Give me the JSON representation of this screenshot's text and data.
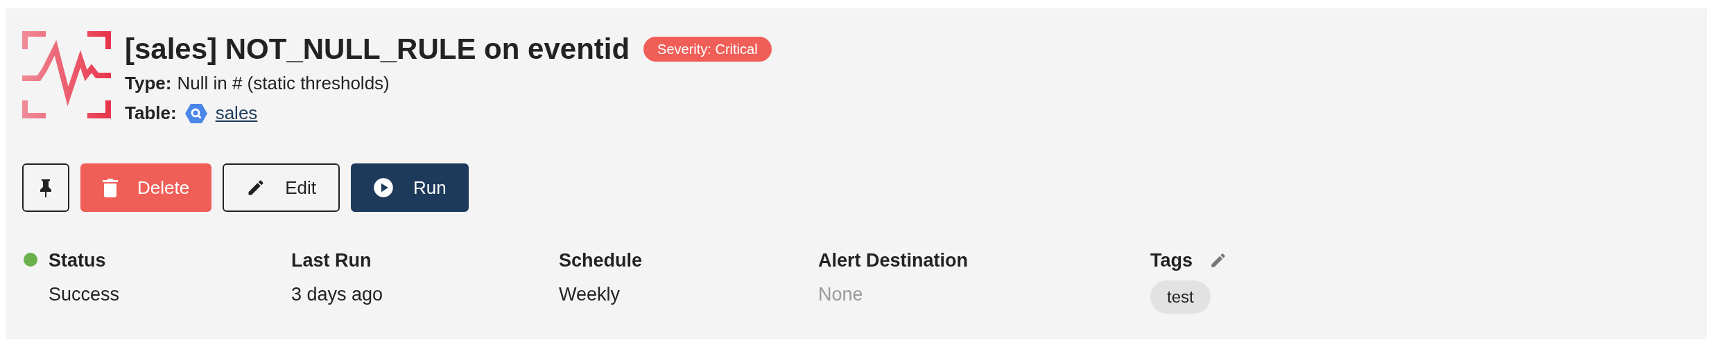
{
  "header": {
    "title": "[sales] NOT_NULL_RULE on eventid",
    "severity": "Severity: Critical",
    "type_label": "Type:",
    "type_value": "Null in # (static thresholds)",
    "table_label": "Table:",
    "table_link": "sales"
  },
  "buttons": [
    {
      "kind": "pin"
    },
    {
      "kind": "delete",
      "label": "Delete"
    },
    {
      "kind": "edit",
      "label": "Edit"
    },
    {
      "kind": "run",
      "label": "Run"
    }
  ],
  "fields": [
    {
      "kind": "status",
      "label": "Status",
      "value": "Success",
      "color": "#6ab04c",
      "muted": false
    },
    {
      "kind": "text",
      "label": "Last Run",
      "value": "3 days ago",
      "muted": false
    },
    {
      "kind": "text",
      "label": "Schedule",
      "value": "Weekly",
      "muted": false
    },
    {
      "kind": "text",
      "label": "Alert Destination",
      "value": "None",
      "muted": true
    },
    {
      "kind": "tags",
      "label": "Tags",
      "tags": [
        "test"
      ]
    }
  ]
}
